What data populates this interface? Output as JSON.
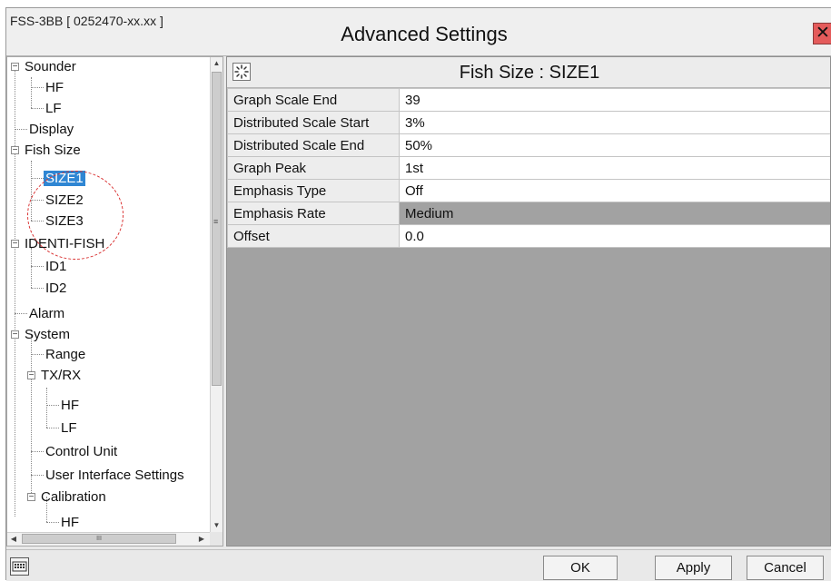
{
  "window": {
    "device_id": "FSS-3BB [ 0252470-xx.xx ]",
    "title": "Advanced Settings",
    "close_glyph": "✕"
  },
  "tree": {
    "items": [
      {
        "label": "Sounder",
        "icon": "collapse-icon"
      },
      {
        "label": "HF"
      },
      {
        "label": "LF"
      },
      {
        "label": "Display"
      },
      {
        "label": "Fish Size",
        "icon": "collapse-icon"
      },
      {
        "label": "SIZE1",
        "selected": true
      },
      {
        "label": "SIZE2"
      },
      {
        "label": "SIZE3"
      },
      {
        "label": "IDENTI-FISH",
        "icon": "collapse-icon"
      },
      {
        "label": "ID1"
      },
      {
        "label": "ID2"
      },
      {
        "label": "Alarm"
      },
      {
        "label": "System",
        "icon": "collapse-icon"
      },
      {
        "label": "Range"
      },
      {
        "label": "TX/RX",
        "icon": "collapse-icon"
      },
      {
        "label": "HF"
      },
      {
        "label": "LF"
      },
      {
        "label": "Control Unit"
      },
      {
        "label": "User Interface Settings"
      },
      {
        "label": "Calibration",
        "icon": "collapse-icon"
      },
      {
        "label": "HF"
      }
    ],
    "hscroll_thumb_glyph": "III"
  },
  "panel": {
    "icon": "settings-panel-icon",
    "title": "Fish Size : SIZE1",
    "rows": [
      {
        "name": "Graph Scale End",
        "value": "39"
      },
      {
        "name": "Distributed Scale Start",
        "value": "3%"
      },
      {
        "name": "Distributed Scale End",
        "value": "50%"
      },
      {
        "name": "Graph Peak",
        "value": "1st"
      },
      {
        "name": "Emphasis Type",
        "value": "Off"
      },
      {
        "name": "Emphasis Rate",
        "value": "Medium",
        "highlighted": true
      },
      {
        "name": "Offset",
        "value": "0.0"
      }
    ]
  },
  "footer": {
    "keyboard_icon": "keyboard-icon",
    "ok_label": "OK",
    "apply_label": "Apply",
    "cancel_label": "Cancel"
  },
  "colors": {
    "selection": "#2f86d3",
    "annotation_circle": "#d93030",
    "close_button": "#e45b5b",
    "panel_background": "#a2a2a2"
  }
}
